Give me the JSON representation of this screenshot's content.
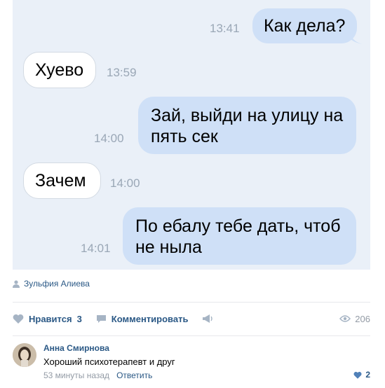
{
  "chat": {
    "messages": [
      {
        "text": "Как дела?",
        "time": "13:41",
        "side": "out"
      },
      {
        "text": "Хуево",
        "time": "13:59",
        "side": "in"
      },
      {
        "text": "Зай, выйди на улицу на пять сек",
        "time": "14:00",
        "side": "out"
      },
      {
        "text": "Зачем",
        "time": "14:00",
        "side": "in"
      },
      {
        "text": "По ебалу тебе дать, чтоб не ныла",
        "time": "14:01",
        "side": "out"
      }
    ],
    "lines": {
      "m3a": "Зай, выйди на улицу на",
      "m3b": "пять сек",
      "m5a": "По ебалу тебе дать, чтоб",
      "m5b": "не ныла"
    }
  },
  "post": {
    "author": "Зульфия Алиева",
    "like_label": "Нравится",
    "like_count": "3",
    "comment_label": "Комментировать",
    "views": "206"
  },
  "comment": {
    "author": "Анна Смирнова",
    "text": "Хороший психотерапевт и друг",
    "time": "53 минуты назад",
    "reply_label": "Ответить",
    "likes": "2"
  },
  "colors": {
    "link": "#2a5885",
    "bubble_out": "#cfe0f7",
    "chat_bg": "#eaf0f8",
    "muted": "#939ba5"
  },
  "icons": [
    "user-icon",
    "heart-icon",
    "comment-icon",
    "share-icon",
    "eye-icon",
    "heart-small-icon"
  ]
}
